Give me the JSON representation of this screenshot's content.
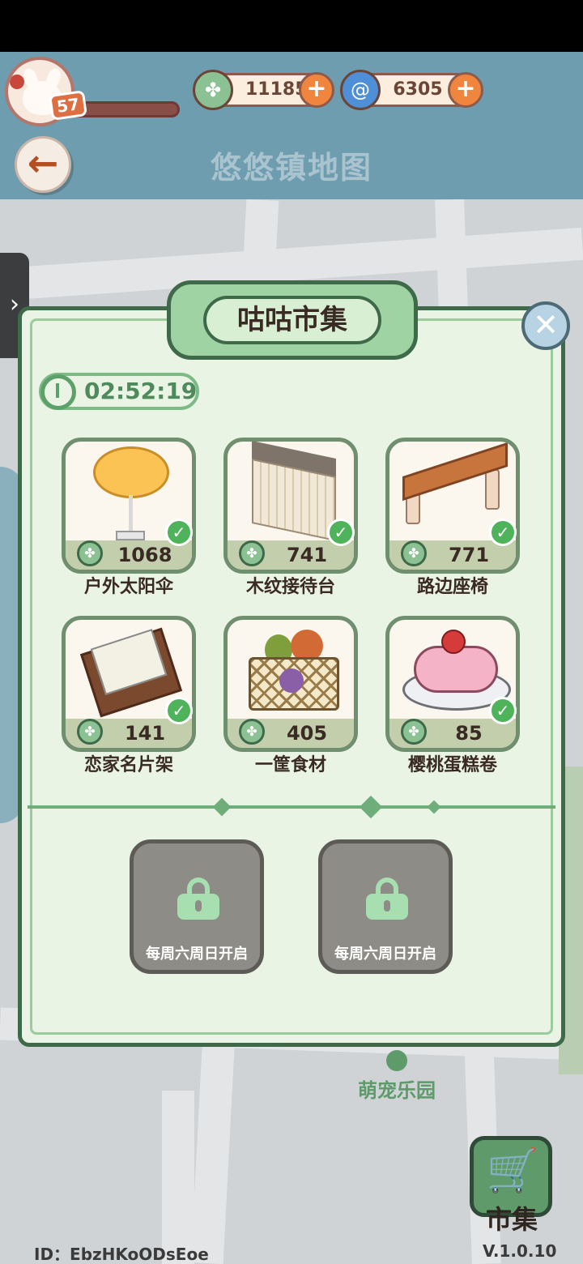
{
  "header": {
    "title": "悠悠镇地图",
    "level": "57",
    "level_progress": 0.1,
    "currencies": [
      {
        "icon": "clover-icon",
        "value": "11185"
      },
      {
        "icon": "swirl-icon",
        "value": "6305"
      }
    ]
  },
  "market": {
    "title": "咕咕市集",
    "timer": "02:52:19",
    "items": [
      {
        "name": "户外太阳伞",
        "price": "1068",
        "owned": true
      },
      {
        "name": "木纹接待台",
        "price": "741",
        "owned": true
      },
      {
        "name": "路边座椅",
        "price": "771",
        "owned": true
      },
      {
        "name": "恋家名片架",
        "price": "141",
        "owned": true
      },
      {
        "name": "一筐食材",
        "price": "405",
        "owned": false
      },
      {
        "name": "樱桃蛋糕卷",
        "price": "85",
        "owned": true
      }
    ],
    "locked_slots": [
      {
        "label": "每周六周日开启"
      },
      {
        "label": "每周六周日开启"
      }
    ]
  },
  "map": {
    "poi_label": "萌宠乐园"
  },
  "bottom": {
    "market_label": "市集",
    "id_text": "ID：EbzHKoODsEoe",
    "version": "V.1.0.10"
  },
  "colors": {
    "primary_green": "#5e9a6a",
    "header_blue": "#6f9db0",
    "accent_orange": "#f0853d"
  }
}
